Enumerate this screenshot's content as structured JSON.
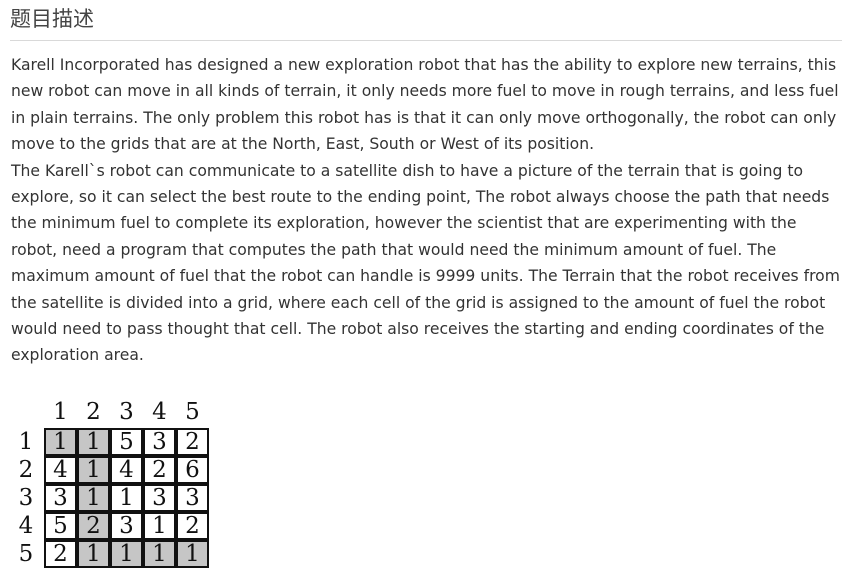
{
  "heading": "题目描述",
  "paragraphs": [
    "Karell Incorporated has designed a new exploration robot that has the ability to explore new terrains, this new robot can move in all kinds of terrain, it only needs more fuel to move in rough terrains, and less fuel in plain terrains. The only problem this robot has is that it can only move orthogonally, the robot can only move to the grids that are at the North, East, South or West of its position.",
    "The Karell`s robot can communicate to a satellite dish to have a picture of the terrain that is going to explore, so it can select the best route to the ending point, The robot always choose the path that needs the minimum fuel to complete its exploration, however the scientist that are experimenting with the robot, need a program that computes the path that would need the minimum amount of fuel. The maximum amount of fuel that the robot can handle is 9999 units. The Terrain that the robot receives from the satellite is divided into a grid, where each cell of the grid is assigned to the amount of fuel the robot would need to pass thought that cell. The robot also receives the starting and ending coordinates of the exploration area."
  ],
  "grid": {
    "col_labels": [
      "1",
      "2",
      "3",
      "4",
      "5"
    ],
    "row_labels": [
      "1",
      "2",
      "3",
      "4",
      "5"
    ],
    "rows": [
      [
        "1",
        "1",
        "5",
        "3",
        "2"
      ],
      [
        "4",
        "1",
        "4",
        "2",
        "6"
      ],
      [
        "3",
        "1",
        "1",
        "3",
        "3"
      ],
      [
        "5",
        "2",
        "3",
        "1",
        "2"
      ],
      [
        "2",
        "1",
        "1",
        "1",
        "1"
      ]
    ],
    "path_cells": [
      [
        0,
        0
      ],
      [
        0,
        1
      ],
      [
        1,
        1
      ],
      [
        2,
        1
      ],
      [
        3,
        1
      ],
      [
        4,
        1
      ],
      [
        4,
        2
      ],
      [
        4,
        3
      ],
      [
        4,
        4
      ]
    ],
    "path_color": "#c6c6c6"
  }
}
